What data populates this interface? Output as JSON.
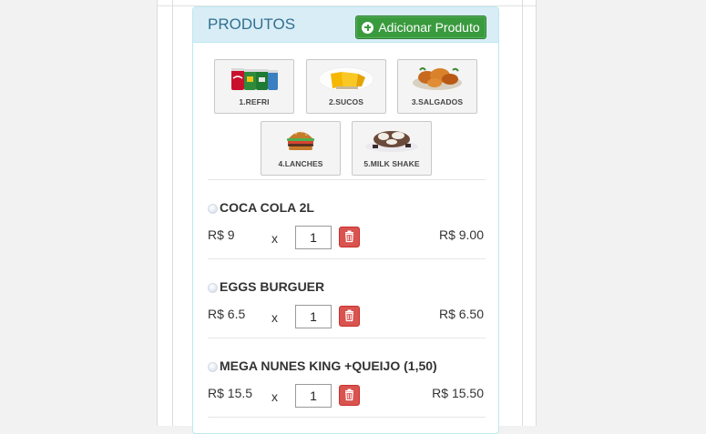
{
  "panel": {
    "title": "PRODUTOS",
    "add_button_label": "Adicionar Produto"
  },
  "categories": [
    {
      "label": "1.REFRI",
      "icon": "soda-cans-icon"
    },
    {
      "label": "2.SUCOS",
      "icon": "juice-icon"
    },
    {
      "label": "3.SALGADOS",
      "icon": "savory-snacks-icon"
    },
    {
      "label": "4.LANCHES",
      "icon": "burger-icon"
    },
    {
      "label": "5.MILK SHAKE",
      "icon": "milkshake-icon"
    }
  ],
  "items": [
    {
      "name": "COCA COLA 2L",
      "price": "R$ 9",
      "times": "x",
      "qty": "1",
      "total": "R$ 9.00"
    },
    {
      "name": "EGGS BURGUER",
      "price": "R$ 6.5",
      "times": "x",
      "qty": "1",
      "total": "R$ 6.50"
    },
    {
      "name": "MEGA NUNES KING +QUEIJO (1,50)",
      "price": "R$ 15.5",
      "times": "x",
      "qty": "1",
      "total": "R$ 15.50"
    }
  ],
  "colors": {
    "heading_bg": "#d9edf7",
    "heading_text": "#31708f",
    "add_button": "#3a9a3e",
    "delete_button": "#d9534f"
  }
}
